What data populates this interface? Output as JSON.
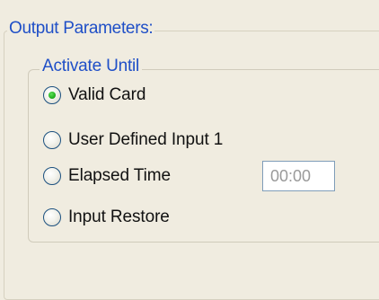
{
  "output_parameters": {
    "title": "Output Parameters:",
    "activate_until": {
      "title": "Activate Until",
      "options": [
        {
          "label": "Valid Card",
          "selected": true
        },
        {
          "label": "User Defined Input 1",
          "selected": false
        },
        {
          "label": "Elapsed Time",
          "selected": false
        },
        {
          "label": "Input Restore",
          "selected": false
        }
      ],
      "elapsed_time_value": "00:00"
    }
  },
  "colors": {
    "background": "#f0ece0",
    "group_title": "#1f4fc7",
    "radio_selected": "#27b424",
    "radio_border": "#1c5180",
    "input_border": "#7f9db9",
    "input_text": "#9a9a9a"
  }
}
